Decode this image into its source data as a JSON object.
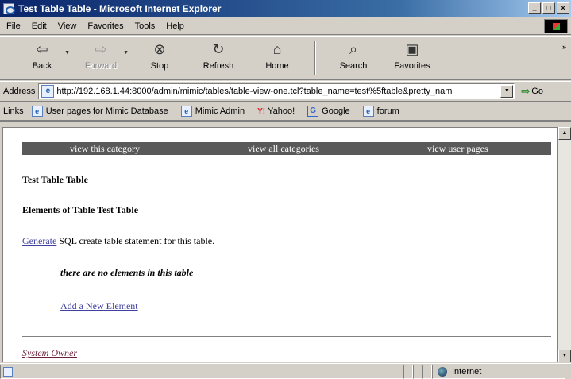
{
  "window": {
    "title": "Test Table Table - Microsoft Internet Explorer",
    "controls": [
      "_",
      "□",
      "×"
    ]
  },
  "menu": {
    "items": [
      "File",
      "Edit",
      "View",
      "Favorites",
      "Tools",
      "Help"
    ]
  },
  "toolbar": {
    "back": "Back",
    "forward": "Forward",
    "stop": "Stop",
    "refresh": "Refresh",
    "home": "Home",
    "search": "Search",
    "favorites": "Favorites"
  },
  "address": {
    "label": "Address",
    "url": "http://192.168.1.44:8000/admin/mimic/tables/table-view-one.tcl?table_name=test%5ftable&pretty_nam",
    "go": "Go"
  },
  "links": {
    "label": "Links",
    "items": [
      "User pages for Mimic Database",
      "Mimic Admin",
      "Yahoo!",
      "Google",
      "forum"
    ]
  },
  "page": {
    "nav": [
      "view this category",
      "view all categories",
      "view user pages"
    ],
    "title": "Test Table Table",
    "subtitle": "Elements of Table Test Table",
    "generate_link": "Generate",
    "generate_text": "SQL create table statement for this table.",
    "empty_message": "there are no elements in this table",
    "add_link": "Add a New Element",
    "owner_link": "System Owner"
  },
  "status": {
    "zone": "Internet"
  }
}
